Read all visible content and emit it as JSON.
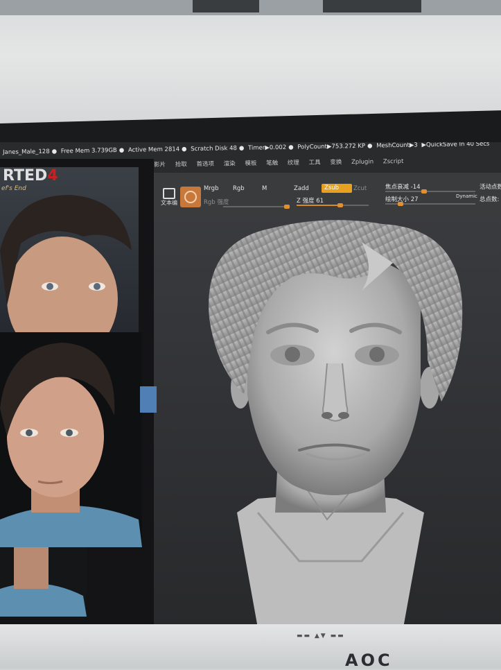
{
  "statusbar": {
    "mesh_name": "Janes_Male_128",
    "free_mem": "Free Mem 3.739GB",
    "active_mem": "Active Mem 2814",
    "scratch_disk": "Scratch Disk 48",
    "timer": "Timer▶0.002",
    "polycount": "PolyCount▶753.272 KP",
    "meshcount": "MeshCount▶3",
    "quicksave": "▶QuickSave In 40 Secs"
  },
  "menu": [
    "影片",
    "拾取",
    "首选项",
    "渲染",
    "模板",
    "笔触",
    "纹理",
    "工具",
    "变换",
    "Zplugin",
    "Zscript"
  ],
  "toolbar": {
    "mrgb": "Mrgb",
    "rgb": "Rgb",
    "m": "M",
    "rgb_intensity": "Rgb 强度",
    "zadd": "Zadd",
    "zsub": "Zsub",
    "zcut": "Zcut",
    "z_intensity": "Z 强度 61",
    "focal_shift": "焦点衰减 -14",
    "draw_size": "绘制大小 27",
    "dynamic": "Dynamic",
    "active_points": "活动点数",
    "total_points": "总点数:",
    "edit_icon_label": "文本编"
  },
  "controls": {
    "z_intensity_value": 61,
    "focal_shift_value": -14,
    "draw_size_value": 27
  },
  "reference": {
    "title_text": "RTED",
    "title_number": "4",
    "subtitle": "ef's End"
  },
  "monitor": {
    "brand": "AOC"
  },
  "colors": {
    "accent": "#e8a020",
    "brush": "#c8783a",
    "viewport": "#2f3033",
    "clay": "#b9b9b9"
  }
}
